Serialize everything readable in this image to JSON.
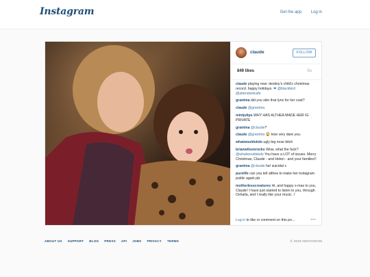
{
  "header": {
    "logo": "Instagram",
    "get_app": "Get the app",
    "login": "Log in"
  },
  "post": {
    "username": "claude",
    "follow_label": "FOLLOW",
    "likes": "849 likes",
    "age": "5o",
    "comments": [
      {
        "user": "claude",
        "parts": [
          {
            "t": " playing now: destiny's child's christmas record. happy holidays. "
          },
          {
            "t": "❤ @blackbird",
            "link": true
          },
          {
            "t": " "
          },
          {
            "t": "@attendantcafe",
            "link": true
          }
        ]
      },
      {
        "user": "grantma",
        "parts": [
          {
            "t": " did you skin that lynx for her coat?"
          }
        ]
      },
      {
        "user": "claude",
        "parts": [
          {
            "t": " "
          },
          {
            "t": "@grantma",
            "link": true
          }
        ]
      },
      {
        "user": "mintjulips",
        "parts": [
          {
            "t": " WHY HAS ALTHEA MADE HER IG PRIVATE"
          }
        ]
      },
      {
        "user": "grantma",
        "parts": [
          {
            "t": " "
          },
          {
            "t": "@claude",
            "link": true
          },
          {
            "t": "?"
          }
        ]
      },
      {
        "user": "claude",
        "parts": [
          {
            "t": " "
          },
          {
            "t": "@grantma",
            "link": true
          },
          {
            "t": " 😱 how very dare you."
          }
        ]
      },
      {
        "user": "whatwouldskdo",
        "parts": [
          {
            "t": " ugly big nose bitch"
          }
        ]
      },
      {
        "user": "brianwilsonrocks",
        "parts": [
          {
            "t": " Wow, what the fuck? "
          },
          {
            "t": "@whatwouldskdo",
            "link": true
          },
          {
            "t": " You have a LOT of issues. Merry Christmas, Claude - and Helen - and your families!!"
          }
        ]
      },
      {
        "user": "grantma",
        "parts": [
          {
            "t": " "
          },
          {
            "t": "@claude",
            "link": true
          },
          {
            "t": " ha! suicidal x"
          }
        ]
      },
      {
        "user": "purelife",
        "parts": [
          {
            "t": " can you tell althea to make her instagram public again plz"
          }
        ]
      },
      {
        "user": "motherlesscreatures",
        "parts": [
          {
            "t": " Hi, and happy x-mas to you, Claude! I have just started to listen to you, through Oshaila, and I really like your music. I"
          }
        ]
      }
    ],
    "login_link": "Log in",
    "login_rest": " to like or comment on this po...",
    "more": "•••"
  },
  "footer": {
    "links": [
      "ABOUT US",
      "SUPPORT",
      "BLOG",
      "PRESS",
      "API",
      "JOBS",
      "PRIVACY",
      "TERMS"
    ],
    "copyright": "© 2015 INSTAGRAM"
  }
}
